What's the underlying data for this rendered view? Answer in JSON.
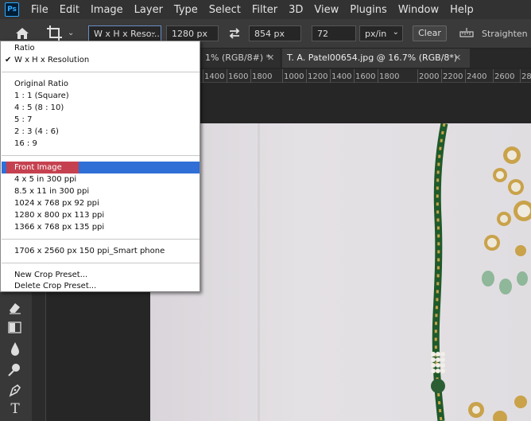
{
  "menubar": {
    "logo": "Ps",
    "items": [
      "File",
      "Edit",
      "Image",
      "Layer",
      "Type",
      "Select",
      "Filter",
      "3D",
      "View",
      "Plugins",
      "Window",
      "Help"
    ]
  },
  "options": {
    "ratio_select": "W x H x Reso...",
    "width": "1280 px",
    "height": "854 px",
    "resolution": "72",
    "unit": "px/in",
    "clear": "Clear",
    "straighten": "Straighten"
  },
  "tabs": [
    {
      "label": "1% (RGB/8#) *"
    },
    {
      "label": "T. A. Patel00654.jpg @ 16.7% (RGB/8*)"
    }
  ],
  "ruler": {
    "labels": [
      "1400",
      "1600",
      "1800",
      "1000",
      "1200",
      "1400",
      "1600",
      "1800",
      "2000",
      "2200",
      "2400",
      "2600",
      "28"
    ]
  },
  "dropdown": {
    "items": [
      {
        "label": "Ratio",
        "checked": false
      },
      {
        "label": "W x H x Resolution",
        "checked": true
      },
      {
        "label": "Original Ratio"
      },
      {
        "label": "1 : 1 (Square)"
      },
      {
        "label": "4 : 5 (8 : 10)"
      },
      {
        "label": "5 : 7"
      },
      {
        "label": "2 : 3 (4 : 6)"
      },
      {
        "label": "16 : 9"
      },
      {
        "label": "Front Image"
      },
      {
        "label": "4 x 5 in 300 ppi"
      },
      {
        "label": "8.5 x 11 in 300 ppi"
      },
      {
        "label": "1024 x 768 px 92 ppi"
      },
      {
        "label": "1280 x 800 px 113 ppi"
      },
      {
        "label": "1366 x 768 px 135 ppi"
      },
      {
        "label": "1706 x 2560 px 150 ppi_Smart phone"
      },
      {
        "label": "New Crop Preset..."
      },
      {
        "label": "Delete Crop Preset..."
      }
    ],
    "check_mark": "✔"
  },
  "colors": {
    "accent": "#2f6fd6",
    "highlight": "#c5414f",
    "menubar_bg": "#323232",
    "necklace_green": "#1f5a2a",
    "gold": "#c9a24a"
  },
  "icons": {
    "home": "home-icon",
    "crop": "crop-icon",
    "swap": "swap-icon",
    "straighten": "straighten-icon",
    "tools": [
      "eraser-icon",
      "gradient-icon",
      "blur-drop-icon",
      "dodge-icon",
      "pen-icon",
      "type-icon"
    ]
  },
  "tool_labels": {
    "type": "T"
  }
}
